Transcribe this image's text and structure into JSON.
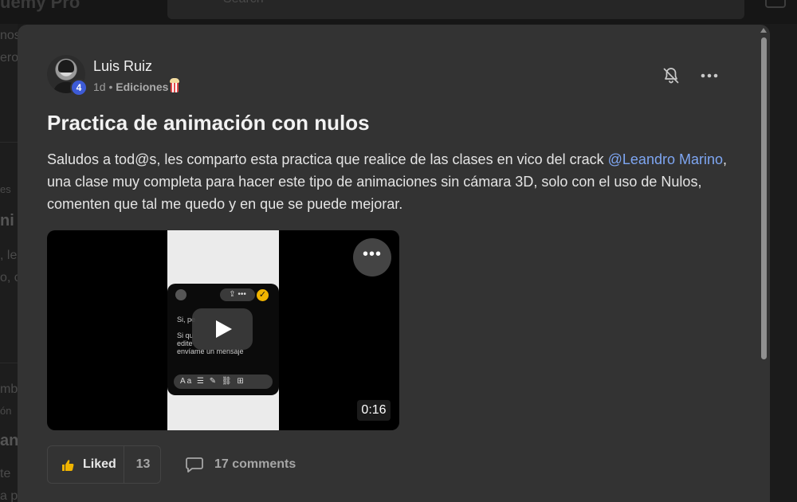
{
  "background": {
    "brand_fragment": "uemy Pro",
    "search_placeholder": "Search",
    "left_fragments": [
      "nos",
      "ero",
      "es",
      "ni",
      ", le",
      "o, c",
      "mb",
      "ón",
      "an",
      "te",
      "a p"
    ]
  },
  "post": {
    "author": {
      "name": "Luis Ruiz",
      "level": "4",
      "level_color": "#3d5bd6"
    },
    "meta": {
      "time": "1d",
      "separator": "•",
      "category": "Ediciones",
      "category_icon": "popcorn-icon"
    },
    "title": "Practica de animación con nulos",
    "body": {
      "before_mention": "Saludos a tod@s, les comparto esta practica que realice de las clases en vico del crack ",
      "mention": "@Leandro Marino",
      "after_mention": ", una clase muy completa para hacer este tipo de animaciones sin cámara 3D, solo con el uso de Nulos, comenten que tal me quedo y en que se puede mejorar.",
      "mention_color": "#7ea6f2"
    },
    "video": {
      "duration": "0:16",
      "menu_label": "•••",
      "preview": {
        "header_pill": "⇪ •••",
        "check": "✓",
        "lines": [
          "Si, pe",
          "",
          "Si qu",
          "edite",
          "envíame un mensaje"
        ],
        "toolbar": "Aa ☰ ✎ ⛓ ⊞"
      }
    },
    "actions": {
      "like_label": "Liked",
      "like_count": "13",
      "comments_label": "17 comments"
    }
  }
}
